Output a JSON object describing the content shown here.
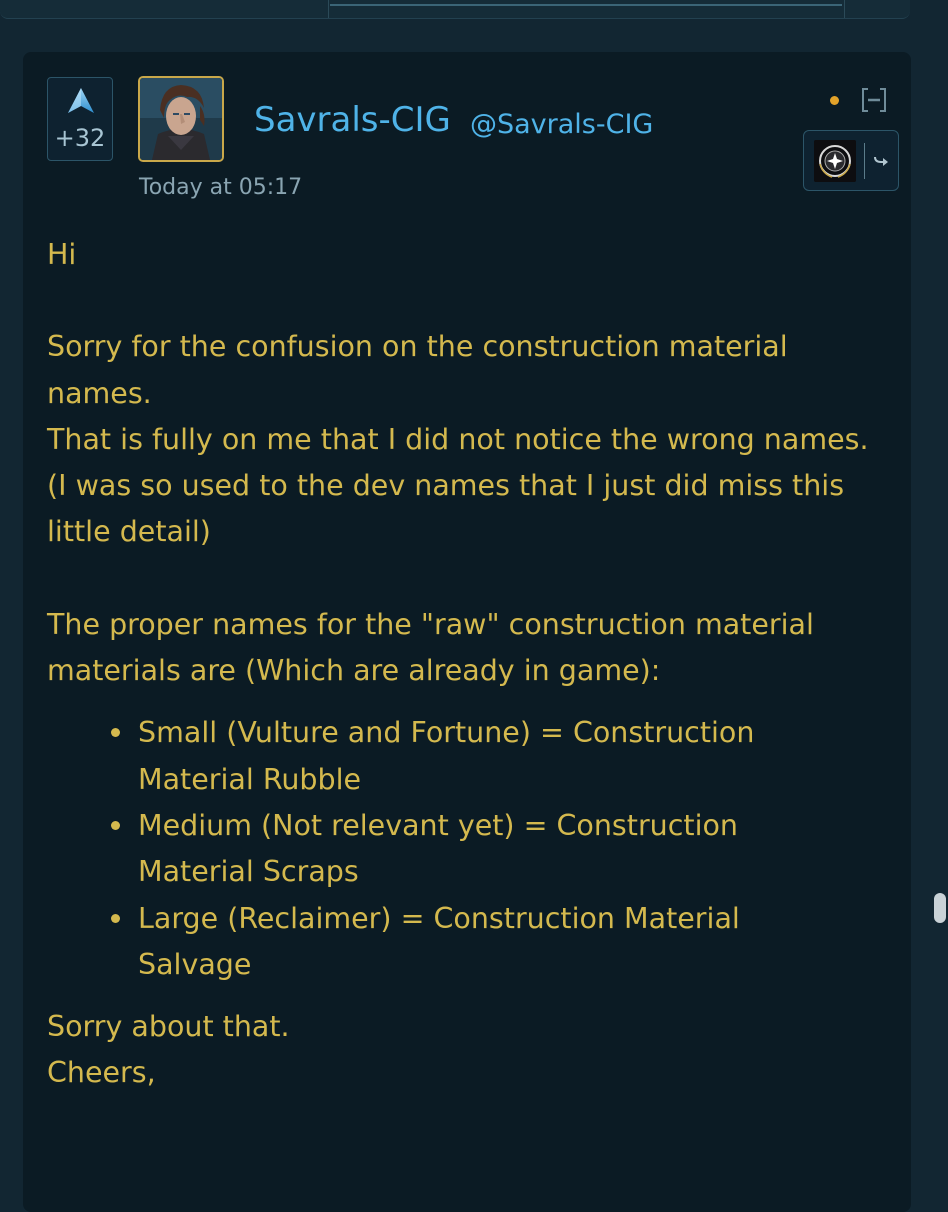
{
  "post": {
    "vote_count": "+32",
    "username": "Savrals-CIG",
    "handle": "@Savrals-CIG",
    "timestamp": "Today at 05:17",
    "icons": {
      "upvote": "upvote-arrow-icon",
      "collapse": "collapse-icon",
      "org_logo": "star-citizen-logo-icon",
      "share": "share-arrow-icon"
    },
    "colors": {
      "body_text": "#d4b94e",
      "username": "#4fb3e8",
      "status_dot": "#e3a32a",
      "avatar_border": "#c9a84a"
    },
    "body": {
      "greeting": "Hi",
      "paragraph1": [
        "Sorry for the confusion on the construction material names.",
        "That is fully on me that I did not notice the wrong names.",
        "(I was so used to the dev names that I just did miss this little detail)"
      ],
      "paragraph2": "The proper names for the \"raw\" construction material materials are (Which are already in game):",
      "list": [
        "Small (Vulture and Fortune) = Construction Material Rubble",
        "Medium (Not relevant yet) = Construction Material Scraps",
        "Large (Reclaimer) = Construction Material Salvage"
      ],
      "closing": [
        "Sorry about that.",
        "Cheers,"
      ]
    }
  }
}
